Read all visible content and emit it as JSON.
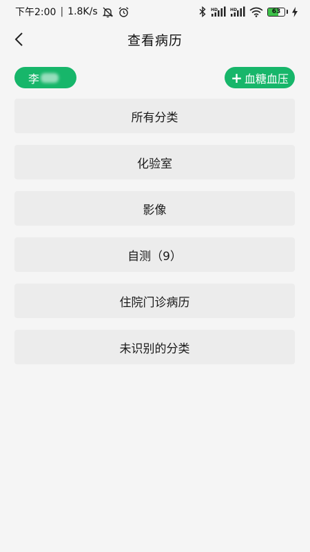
{
  "status_bar": {
    "time": "下午2:00",
    "speed": "1.8K/s",
    "separator": "|",
    "icons": [
      "mute-bell-icon",
      "alarm-icon",
      "bluetooth-icon",
      "hd-signal-icon",
      "hd-signal-icon",
      "wifi-icon",
      "battery-icon",
      "charging-icon"
    ],
    "battery_level": "63",
    "battery_fraction": 0.63
  },
  "header": {
    "back_icon": "chevron-left-icon",
    "title": "查看病历"
  },
  "patient": {
    "name": "李"
  },
  "add_button": {
    "icon": "plus-icon",
    "plus": "+",
    "label": "血糖血压"
  },
  "categories": [
    {
      "label": "所有分类"
    },
    {
      "label": "化验室"
    },
    {
      "label": "影像"
    },
    {
      "label": "自测（9）"
    },
    {
      "label": "住院门诊病历"
    },
    {
      "label": "未识别的分类"
    }
  ],
  "colors": {
    "accent": "#17b66a",
    "background": "#f5f5f5",
    "card": "#ececec",
    "battery_fill": "#3ec24a"
  }
}
